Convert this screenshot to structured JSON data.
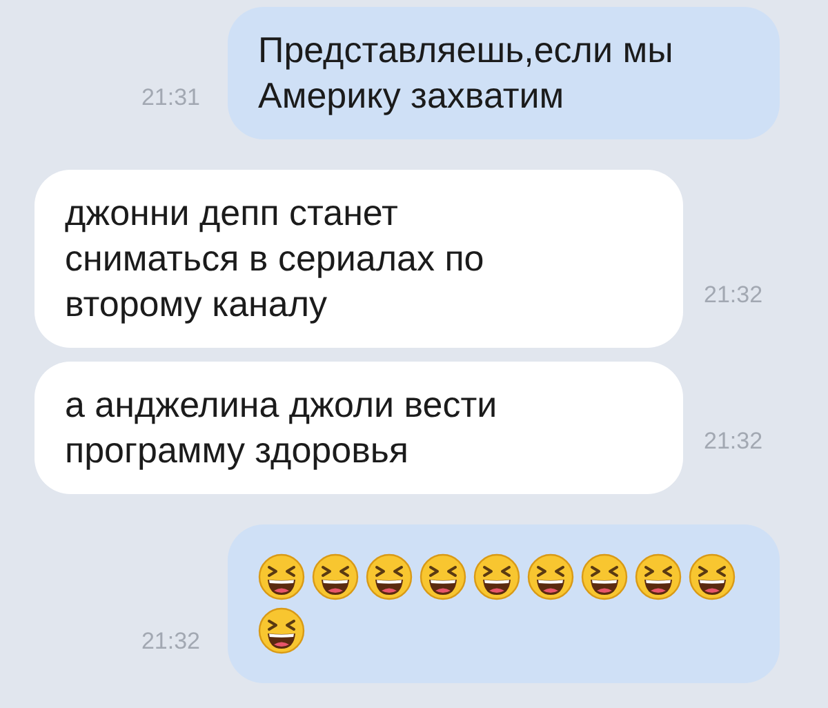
{
  "messages": [
    {
      "sent": true,
      "kind": "text",
      "text": "Представляешь,если мы\nАмерику захватим",
      "time": "21:31"
    },
    {
      "sent": false,
      "kind": "text",
      "text": "джонни депп станет\nсниматься в сериалах по\nвторому каналу",
      "time": "21:32"
    },
    {
      "sent": false,
      "kind": "text",
      "text": "а анджелина джоли вести\nпрограмму здоровья",
      "time": "21:32"
    },
    {
      "sent": true,
      "kind": "emoji",
      "emojis": [
        {
          "kind": "laughing"
        },
        {
          "kind": "laughing"
        },
        {
          "kind": "laughing"
        },
        {
          "kind": "laughing"
        },
        {
          "kind": "laughing"
        },
        {
          "kind": "laughing"
        },
        {
          "kind": "laughing"
        },
        {
          "kind": "laughing"
        },
        {
          "kind": "laughing"
        },
        {
          "kind": "laughing"
        }
      ],
      "time": "21:32"
    }
  ]
}
